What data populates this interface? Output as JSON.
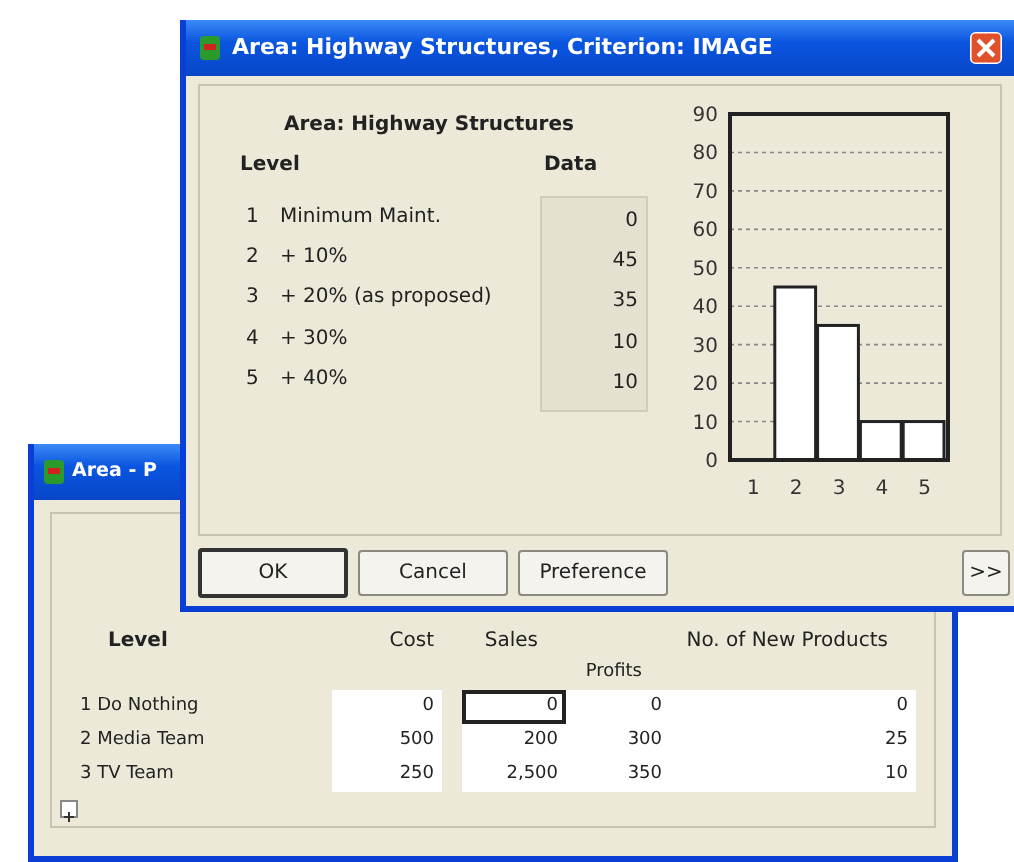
{
  "back_window": {
    "title": "Area - P",
    "columns": [
      {
        "label": "Level"
      },
      {
        "label": "Cost"
      },
      {
        "label": "Sales"
      },
      {
        "label": "Profits"
      },
      {
        "label": "No. of New Products"
      }
    ],
    "rows": [
      {
        "cells": [
          {
            "text": "1 Do Nothing",
            "selected": false
          },
          {
            "text": "0",
            "selected": false
          },
          {
            "text": "0",
            "selected": true
          },
          {
            "text": "0",
            "selected": false
          },
          {
            "text": "0",
            "selected": false
          }
        ]
      },
      {
        "cells": [
          {
            "text": "2 Media Team",
            "selected": false
          },
          {
            "text": "500",
            "selected": false
          },
          {
            "text": "200",
            "selected": false
          },
          {
            "text": "300",
            "selected": false
          },
          {
            "text": "25",
            "selected": false
          }
        ]
      },
      {
        "cells": [
          {
            "text": "3 TV Team",
            "selected": false
          },
          {
            "text": "250",
            "selected": false
          },
          {
            "text": "2,500",
            "selected": false
          },
          {
            "text": "350",
            "selected": false
          },
          {
            "text": "10",
            "selected": false
          }
        ]
      }
    ]
  },
  "front_window": {
    "title": "Area: Highway Structures, Criterion: IMAGE",
    "heading": "Area: Highway Structures",
    "level_header": "Level",
    "data_header": "Data",
    "rows": [
      {
        "number": "1",
        "label": "Minimum Maint.",
        "data": "0"
      },
      {
        "number": "2",
        "label": "+ 10%",
        "data": "45"
      },
      {
        "number": "3",
        "label": "+ 20% (as proposed)",
        "data": "35"
      },
      {
        "number": "4",
        "label": "+ 30%",
        "data": "10"
      },
      {
        "number": "5",
        "label": "+ 40%",
        "data": "10"
      }
    ],
    "chart_data": {
      "type": "bar",
      "categories": [
        "1",
        "2",
        "3",
        "4",
        "5"
      ],
      "values": [
        0,
        45,
        35,
        10,
        10
      ],
      "ylim": [
        0,
        90
      ],
      "yticks": [
        0,
        10,
        20,
        30,
        40,
        50,
        60,
        70,
        80,
        90
      ],
      "grid": true
    },
    "buttons": [
      {
        "label": "OK",
        "default": true
      },
      {
        "label": "Cancel",
        "default": false
      },
      {
        "label": "Preference",
        "default": false
      }
    ],
    "more_button": ">>"
  }
}
